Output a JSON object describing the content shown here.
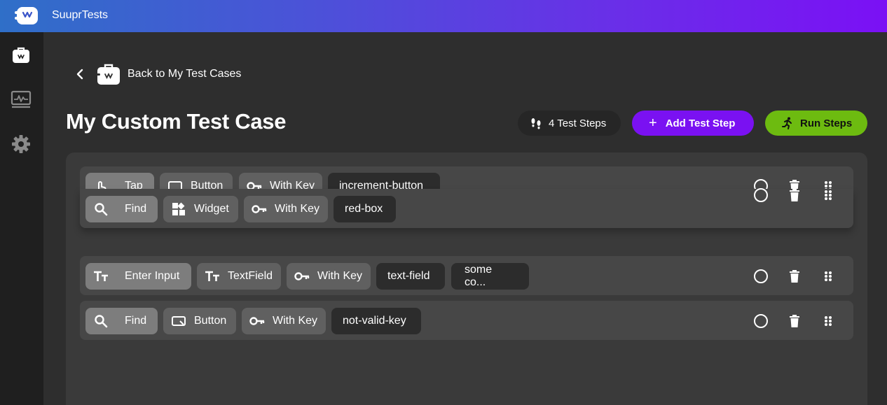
{
  "app": {
    "title": "SuuprTests"
  },
  "nav": {
    "back_label": "Back to My Test Cases"
  },
  "page": {
    "title": "My Custom Test Case",
    "steps_count": "4 Test Steps",
    "add_step_label": "Add Test Step",
    "run_steps_label": "Run Steps"
  },
  "colors": {
    "accent": "#7a11f2",
    "run": "#6dbb10"
  },
  "steps": [
    {
      "action": "Tap",
      "kind": "Button",
      "by": "With Key",
      "value": "increment-button",
      "extra": ""
    },
    {
      "action": "Find",
      "kind": "Widget",
      "by": "With Key",
      "value": "red-box",
      "extra": ""
    },
    {
      "action": "Enter Input",
      "kind": "TextField",
      "by": "With Key",
      "value": "text-field",
      "extra": "some co..."
    },
    {
      "action": "Find",
      "kind": "Button",
      "by": "With Key",
      "value": "not-valid-key",
      "extra": ""
    }
  ]
}
